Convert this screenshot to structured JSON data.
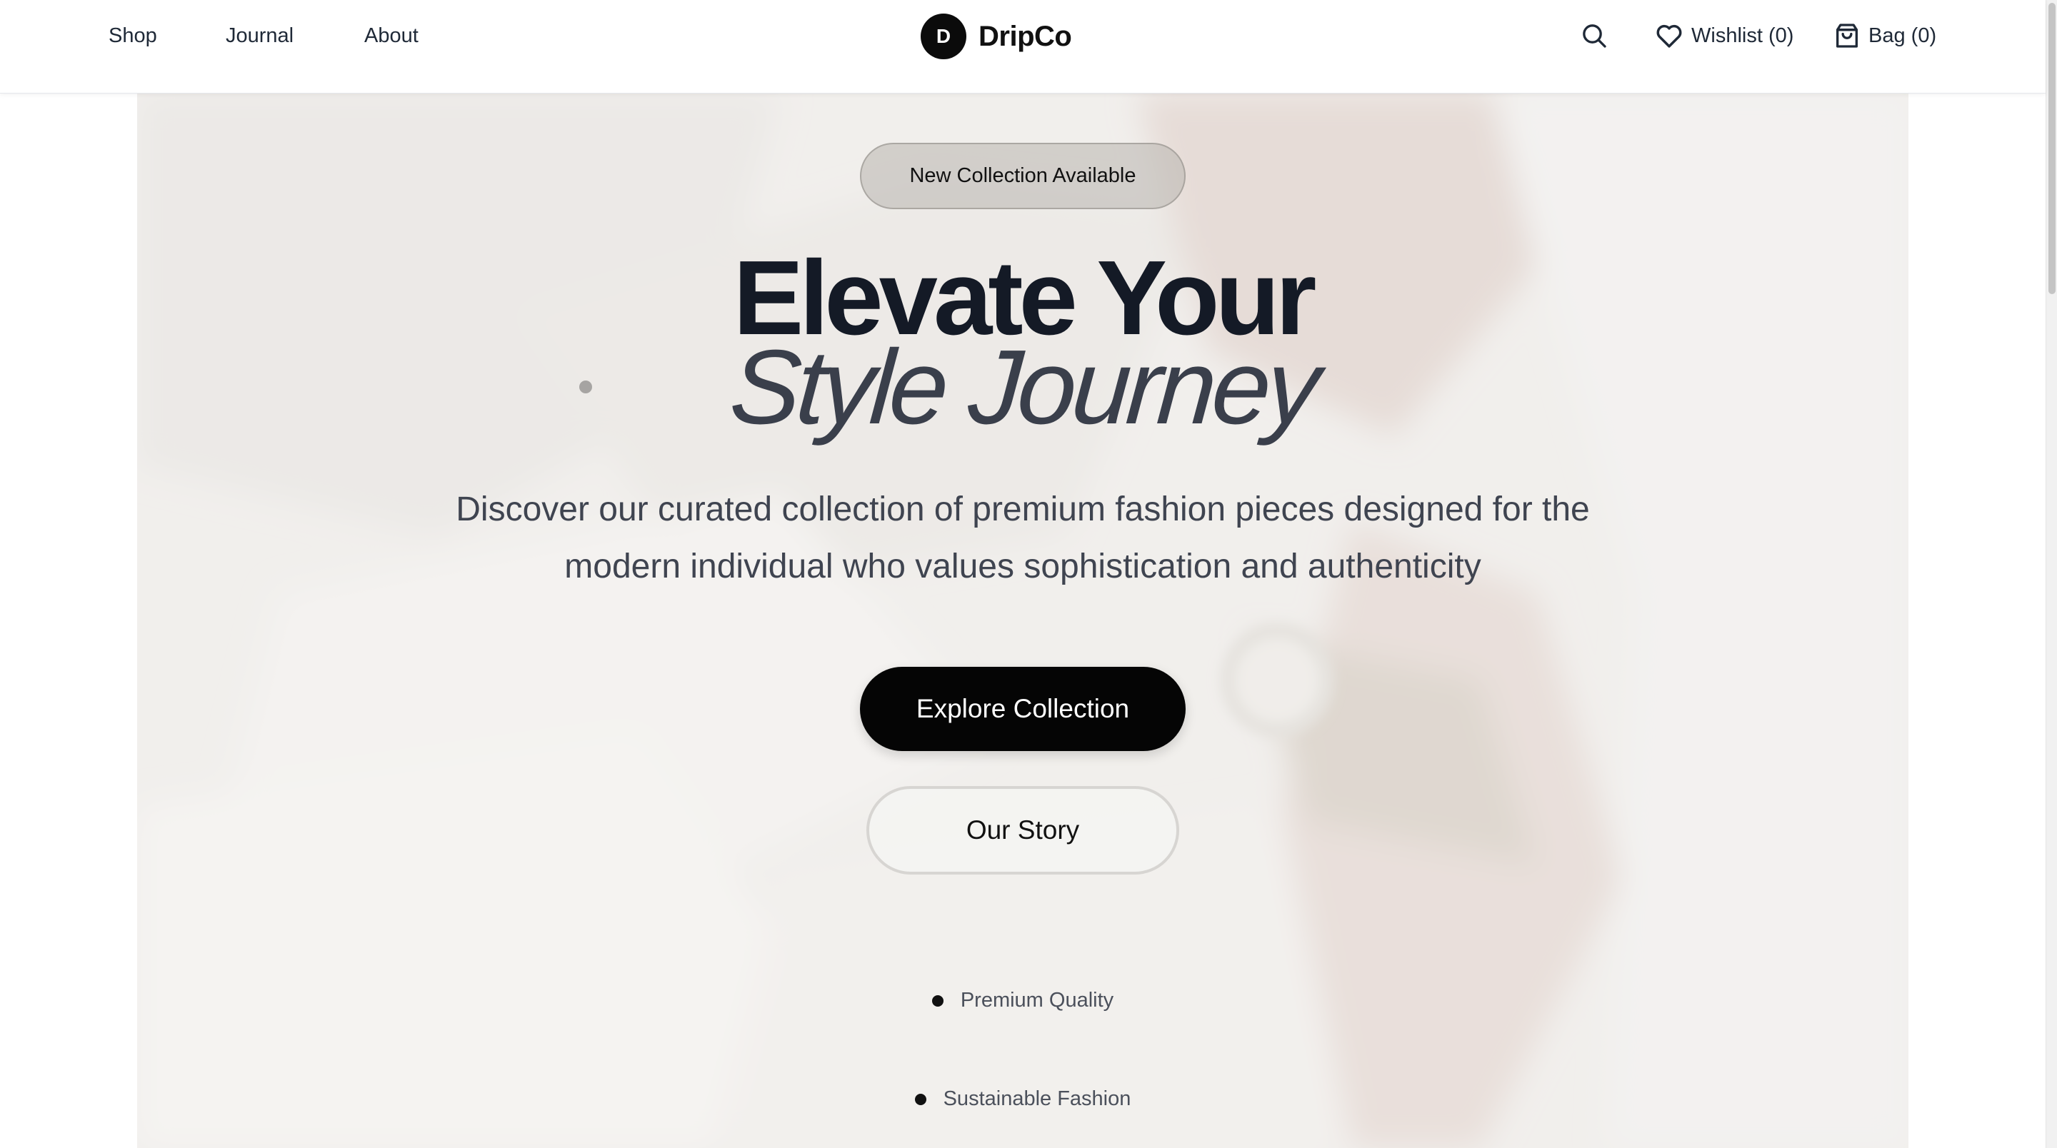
{
  "header": {
    "nav": [
      {
        "label": "Shop"
      },
      {
        "label": "Journal"
      },
      {
        "label": "About"
      }
    ],
    "brand": {
      "mark": "D",
      "name": "DripCo"
    },
    "actions": {
      "search_icon": "search-icon",
      "wishlist_label": "Wishlist (0)",
      "wishlist_icon": "heart-icon",
      "bag_label": "Bag (0)",
      "bag_icon": "shopping-bag-icon"
    }
  },
  "hero": {
    "badge": "New Collection Available",
    "headline_line1": "Elevate Your",
    "headline_line2": "Style Journey",
    "subtitle": "Discover our curated collection of premium fashion pieces designed for the modern individual who values sophistication and authenticity",
    "primary_cta": "Explore Collection",
    "secondary_cta": "Our Story",
    "features": [
      "Premium Quality",
      "Sustainable Fashion"
    ]
  },
  "colors": {
    "primary": "#050505",
    "headline": "#141a26",
    "body_text": "#3f4450",
    "background": "#ffffff"
  }
}
